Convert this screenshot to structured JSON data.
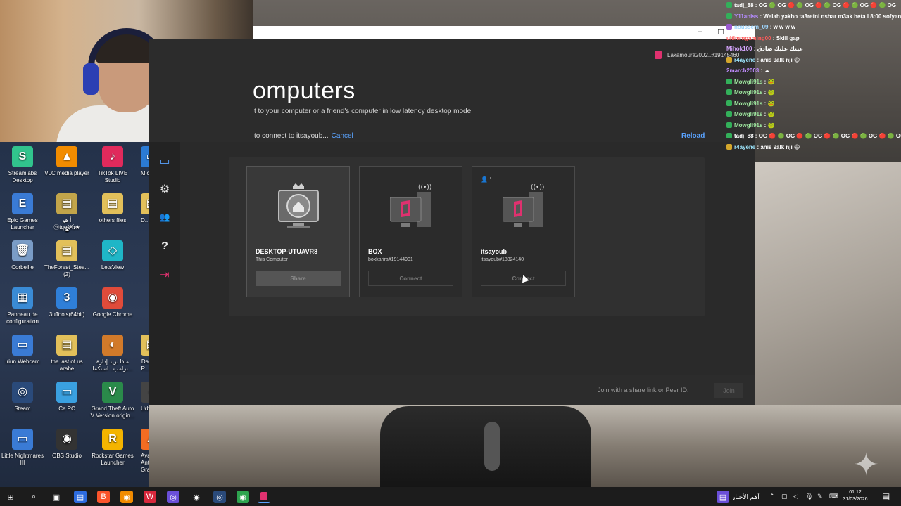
{
  "window": {
    "title": "omputers",
    "subtitle": "t to your computer or a friend's computer in low latency desktop mode.",
    "status": "to connect to itsayoub...",
    "cancel_label": "Cancel",
    "reload_label": "Reload",
    "user": "Lakamoura2002..#19145460",
    "min_glyph": "–",
    "max_glyph": "☐"
  },
  "sidebar": [
    {
      "name": "computers-icon",
      "glyph": "▭"
    },
    {
      "name": "settings-icon",
      "glyph": "⚙"
    },
    {
      "name": "friends-icon",
      "glyph": "👥"
    },
    {
      "name": "help-icon",
      "glyph": "?"
    },
    {
      "name": "logout-icon",
      "glyph": "⇥"
    }
  ],
  "cards": [
    {
      "name": "DESKTOP-UTUAVR8",
      "sub": "This Computer",
      "button": "Share",
      "guests": ""
    },
    {
      "name": "BOX",
      "sub": "boxkarira#19144901",
      "button": "Connect",
      "guests": ""
    },
    {
      "name": "itsayoub",
      "sub": "itsayoub#18324140",
      "button": "Connect",
      "guests": "1"
    }
  ],
  "footer": {
    "hint": "Join with a share link or Peer ID.",
    "join_label": "Join"
  },
  "desktop_icons": [
    {
      "label": "Streamlabs Desktop",
      "color": "#31c48d",
      "glyph": "S"
    },
    {
      "label": "VLC media player",
      "color": "#f28c00",
      "glyph": "▲"
    },
    {
      "label": "TikTok LIVE Studio",
      "color": "#e02a5c",
      "glyph": "♪"
    },
    {
      "label": "Epic Games Launcher",
      "color": "#3a7bd5",
      "glyph": "E"
    },
    {
      "label": "أ هو\n㋡tqẹ̷̥̣̤̩̮̯̲̹̺̻̼͈̩̥̣̤̩̮̯̲̹̺̻̼͈ṡ̷ⱁ̸ḣ̷★",
      "color": "#c2a54a",
      "glyph": "▤"
    },
    {
      "label": "others files",
      "color": "#e2c05a",
      "glyph": "▤"
    },
    {
      "label": "Corbeille",
      "color": "#7a9cc6",
      "glyph": "🗑"
    },
    {
      "label": "TheForest_Stea... (2)",
      "color": "#e2c05a",
      "glyph": "▤"
    },
    {
      "label": "LetsView",
      "color": "#1fb6c7",
      "glyph": "◇"
    },
    {
      "label": "Panneau de configuration",
      "color": "#3a8bd5",
      "glyph": "▦"
    },
    {
      "label": "3uTools(64bit)",
      "color": "#2f7fd8",
      "glyph": "3"
    },
    {
      "label": "Google Chrome",
      "color": "#e04b3a",
      "glyph": "◉"
    },
    {
      "label": "Iriun Webcam",
      "color": "#3a7bd5",
      "glyph": "▭"
    },
    {
      "label": "the last of us arabe",
      "color": "#e2c05a",
      "glyph": "▤"
    },
    {
      "label": "ماذا تريد إدارة ترامب.. استكما...",
      "color": "#d27a2a",
      "glyph": "◐"
    },
    {
      "label": "Steam",
      "color": "#2a4a7a",
      "glyph": "◎"
    },
    {
      "label": "Ce PC",
      "color": "#3aa0e0",
      "glyph": "▭"
    },
    {
      "label": "Grand Theft Auto V Version origin...",
      "color": "#2a8a4a",
      "glyph": "V"
    },
    {
      "label": "Little Nightmares III",
      "color": "#3a7bd5",
      "glyph": "▭"
    },
    {
      "label": "OBS Studio",
      "color": "#333333",
      "glyph": "◉"
    },
    {
      "label": "Rockstar Games Launcher",
      "color": "#f4b400",
      "glyph": "R"
    },
    {
      "label": "Avast Antivirus Gratuit",
      "color": "#f26c22",
      "glyph": "A"
    },
    {
      "label": "Micr...",
      "color": "#2b7bd5",
      "glyph": "▭"
    },
    {
      "label": "D...",
      "color": "#e2c05a",
      "glyph": "▤"
    },
    {
      "label": "UrbanVPN",
      "color": "#444444",
      "glyph": "◐"
    },
    {
      "label": "Da P...",
      "color": "#e2c05a",
      "glyph": "▤"
    }
  ],
  "chat": [
    {
      "user": "tadj_88",
      "color": "#ffffff",
      "msg": ": OG 🟢 OG 🔴 🟢 OG 🔴 🟢 OG 🔴 🟢 OG 🔴 🟢 OG",
      "badge": "g"
    },
    {
      "user": "Y11aniss",
      "color": "#b58cff",
      "msg": ": Welah yakho ta3refni nshar m3ak heta l 8:00 sofyan",
      "badge": "g"
    },
    {
      "user": "noussem_09",
      "color": "#9fd7ff",
      "msg": ": w w w w",
      "badge": "p"
    },
    {
      "user": "ultimmgaming00",
      "color": "#ff5a5a",
      "msg": ": Skill gap",
      "badge": ""
    },
    {
      "user": "Mihok100",
      "color": "#d6a6ff",
      "msg": ": عينك عليك صادق",
      "badge": ""
    },
    {
      "user": "r4ayene",
      "color": "#9fe8ff",
      "msg": ": anis 9alk nji 😆",
      "badge": "y"
    },
    {
      "user": "2march2003",
      "color": "#c08cff",
      "msg": ": ☁",
      "badge": ""
    },
    {
      "user": "Mowgli91s",
      "color": "#9fe8a0",
      "msg": ": 🐸",
      "badge": "g"
    },
    {
      "user": "Mowgli91s",
      "color": "#9fe8a0",
      "msg": ": 🐸",
      "badge": "g"
    },
    {
      "user": "Mowgli91s",
      "color": "#9fe8a0",
      "msg": ": 🐸",
      "badge": "g"
    },
    {
      "user": "Mowgli91s",
      "color": "#9fe8a0",
      "msg": ": 🐸",
      "badge": "g"
    },
    {
      "user": "Mowgli91s",
      "color": "#9fe8a0",
      "msg": ": 🐸",
      "badge": "g"
    },
    {
      "user": "tadj_88",
      "color": "#ffffff",
      "msg": ": OG 🔴 🟢 OG 🔴 🟢 OG 🔴 🟢 OG 🔴 🟢 OG 🔴 🟢 OG",
      "badge": "g"
    },
    {
      "user": "r4ayene",
      "color": "#9fe8ff",
      "msg": ": anis 9alk nji 😆",
      "badge": "y"
    }
  ],
  "taskbar": {
    "news": "أهم الأخبار",
    "time": "01:12",
    "date": "31/03/2026"
  }
}
